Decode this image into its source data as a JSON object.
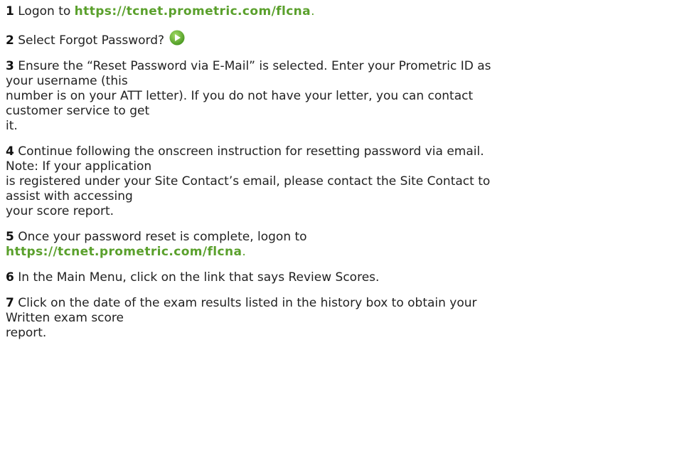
{
  "steps": [
    {
      "number": "1",
      "text_before": "Logon to ",
      "link": "https://tcnet.prometric.com/flcna",
      "text_after": "."
    },
    {
      "number": "2",
      "text": "Select Forgot Password?",
      "icon": "play-icon",
      "icon_color": "#5aa02c"
    },
    {
      "number": "3",
      "lines": [
        "Ensure the “Reset Password via E-Mail” is selected. Enter your Prometric ID as",
        "your username (this",
        "number is on your ATT letter). If you do not have your letter, you can contact",
        "customer service to get",
        "it."
      ]
    },
    {
      "number": "4",
      "lines": [
        "Continue following the onscreen instruction for resetting password via email.",
        "Note: If your application",
        "is registered under your Site Contact’s email, please contact the Site Contact to",
        "assist with accessing",
        "your score report."
      ]
    },
    {
      "number": "5",
      "text": "Once your password reset is complete, logon to",
      "link": "https://tcnet.prometric.com/flcna",
      "text_after": "."
    },
    {
      "number": "6",
      "text": "In the Main Menu, click on the link that says Review Scores."
    },
    {
      "number": "7",
      "lines": [
        "Click on the date of the exam results listed in the history box to obtain your",
        "Written exam score",
        "report."
      ]
    }
  ],
  "colors": {
    "link": "#5aa02c",
    "text": "#222222"
  }
}
